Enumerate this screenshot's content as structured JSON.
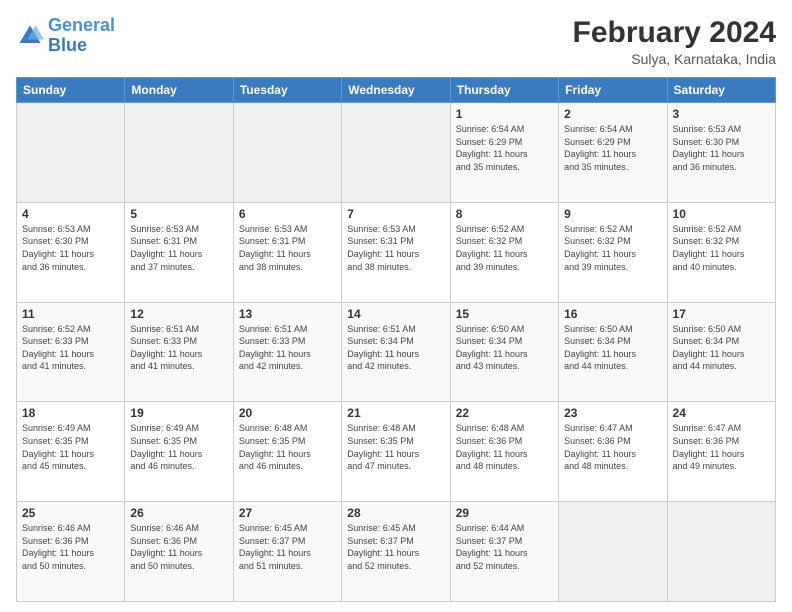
{
  "logo": {
    "line1": "General",
    "line2": "Blue"
  },
  "title": "February 2024",
  "subtitle": "Sulya, Karnataka, India",
  "days_of_week": [
    "Sunday",
    "Monday",
    "Tuesday",
    "Wednesday",
    "Thursday",
    "Friday",
    "Saturday"
  ],
  "weeks": [
    [
      {
        "num": "",
        "info": ""
      },
      {
        "num": "",
        "info": ""
      },
      {
        "num": "",
        "info": ""
      },
      {
        "num": "",
        "info": ""
      },
      {
        "num": "1",
        "info": "Sunrise: 6:54 AM\nSunset: 6:29 PM\nDaylight: 11 hours\nand 35 minutes."
      },
      {
        "num": "2",
        "info": "Sunrise: 6:54 AM\nSunset: 6:29 PM\nDaylight: 11 hours\nand 35 minutes."
      },
      {
        "num": "3",
        "info": "Sunrise: 6:53 AM\nSunset: 6:30 PM\nDaylight: 11 hours\nand 36 minutes."
      }
    ],
    [
      {
        "num": "4",
        "info": "Sunrise: 6:53 AM\nSunset: 6:30 PM\nDaylight: 11 hours\nand 36 minutes."
      },
      {
        "num": "5",
        "info": "Sunrise: 6:53 AM\nSunset: 6:31 PM\nDaylight: 11 hours\nand 37 minutes."
      },
      {
        "num": "6",
        "info": "Sunrise: 6:53 AM\nSunset: 6:31 PM\nDaylight: 11 hours\nand 38 minutes."
      },
      {
        "num": "7",
        "info": "Sunrise: 6:53 AM\nSunset: 6:31 PM\nDaylight: 11 hours\nand 38 minutes."
      },
      {
        "num": "8",
        "info": "Sunrise: 6:52 AM\nSunset: 6:32 PM\nDaylight: 11 hours\nand 39 minutes."
      },
      {
        "num": "9",
        "info": "Sunrise: 6:52 AM\nSunset: 6:32 PM\nDaylight: 11 hours\nand 39 minutes."
      },
      {
        "num": "10",
        "info": "Sunrise: 6:52 AM\nSunset: 6:32 PM\nDaylight: 11 hours\nand 40 minutes."
      }
    ],
    [
      {
        "num": "11",
        "info": "Sunrise: 6:52 AM\nSunset: 6:33 PM\nDaylight: 11 hours\nand 41 minutes."
      },
      {
        "num": "12",
        "info": "Sunrise: 6:51 AM\nSunset: 6:33 PM\nDaylight: 11 hours\nand 41 minutes."
      },
      {
        "num": "13",
        "info": "Sunrise: 6:51 AM\nSunset: 6:33 PM\nDaylight: 11 hours\nand 42 minutes."
      },
      {
        "num": "14",
        "info": "Sunrise: 6:51 AM\nSunset: 6:34 PM\nDaylight: 11 hours\nand 42 minutes."
      },
      {
        "num": "15",
        "info": "Sunrise: 6:50 AM\nSunset: 6:34 PM\nDaylight: 11 hours\nand 43 minutes."
      },
      {
        "num": "16",
        "info": "Sunrise: 6:50 AM\nSunset: 6:34 PM\nDaylight: 11 hours\nand 44 minutes."
      },
      {
        "num": "17",
        "info": "Sunrise: 6:50 AM\nSunset: 6:34 PM\nDaylight: 11 hours\nand 44 minutes."
      }
    ],
    [
      {
        "num": "18",
        "info": "Sunrise: 6:49 AM\nSunset: 6:35 PM\nDaylight: 11 hours\nand 45 minutes."
      },
      {
        "num": "19",
        "info": "Sunrise: 6:49 AM\nSunset: 6:35 PM\nDaylight: 11 hours\nand 46 minutes."
      },
      {
        "num": "20",
        "info": "Sunrise: 6:48 AM\nSunset: 6:35 PM\nDaylight: 11 hours\nand 46 minutes."
      },
      {
        "num": "21",
        "info": "Sunrise: 6:48 AM\nSunset: 6:35 PM\nDaylight: 11 hours\nand 47 minutes."
      },
      {
        "num": "22",
        "info": "Sunrise: 6:48 AM\nSunset: 6:36 PM\nDaylight: 11 hours\nand 48 minutes."
      },
      {
        "num": "23",
        "info": "Sunrise: 6:47 AM\nSunset: 6:36 PM\nDaylight: 11 hours\nand 48 minutes."
      },
      {
        "num": "24",
        "info": "Sunrise: 6:47 AM\nSunset: 6:36 PM\nDaylight: 11 hours\nand 49 minutes."
      }
    ],
    [
      {
        "num": "25",
        "info": "Sunrise: 6:46 AM\nSunset: 6:36 PM\nDaylight: 11 hours\nand 50 minutes."
      },
      {
        "num": "26",
        "info": "Sunrise: 6:46 AM\nSunset: 6:36 PM\nDaylight: 11 hours\nand 50 minutes."
      },
      {
        "num": "27",
        "info": "Sunrise: 6:45 AM\nSunset: 6:37 PM\nDaylight: 11 hours\nand 51 minutes."
      },
      {
        "num": "28",
        "info": "Sunrise: 6:45 AM\nSunset: 6:37 PM\nDaylight: 11 hours\nand 52 minutes."
      },
      {
        "num": "29",
        "info": "Sunrise: 6:44 AM\nSunset: 6:37 PM\nDaylight: 11 hours\nand 52 minutes."
      },
      {
        "num": "",
        "info": ""
      },
      {
        "num": "",
        "info": ""
      }
    ]
  ]
}
